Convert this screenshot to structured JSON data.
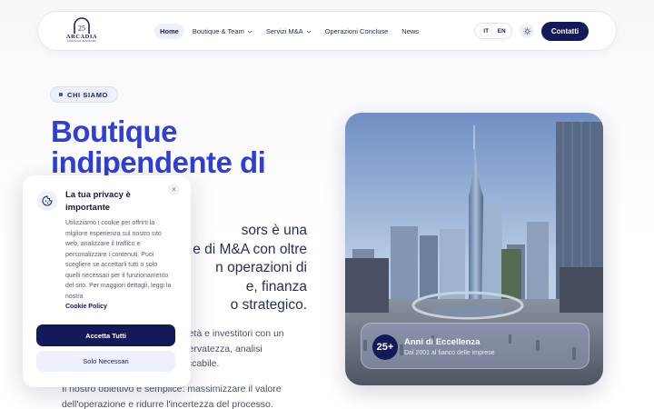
{
  "brand": {
    "logo_number": "25",
    "logo_name": "ARCADIA",
    "logo_tagline": "FINANCIAL ADVISORS"
  },
  "nav": {
    "items": [
      {
        "label": "Home",
        "active": true,
        "has_dropdown": false
      },
      {
        "label": "Boutique & Team",
        "active": false,
        "has_dropdown": true
      },
      {
        "label": "Servizi M&A",
        "active": false,
        "has_dropdown": true
      },
      {
        "label": "Operazioni Concluse",
        "active": false,
        "has_dropdown": false
      },
      {
        "label": "News",
        "active": false,
        "has_dropdown": false
      }
    ],
    "lang_it": "IT",
    "lang_en": "EN",
    "theme_icon": "sun-icon",
    "contact_label": "Contatti"
  },
  "hero": {
    "badge": "CHI SIAMO",
    "title": "Boutique indipendente di",
    "lead_visible": "sors è una\ne di M&A con oltre\nn operazioni di\ne, finanza\no strategico.",
    "body1_visible": "cietà e investitori con un\niservatezza, analisi\neccabile.",
    "body2": "Il nostro obiettivo è semplice: massimizzare il valore dell'operazione e ridurre l'incertezza del processo."
  },
  "stat": {
    "number": "25+",
    "title": "Anni di Eccellenza",
    "subtitle": "Dal 2001 al fianco delle imprese"
  },
  "cookie": {
    "icon": "cookie-icon",
    "title": "La tua privacy è importante",
    "text": "Utilizziamo i cookie per offrirti la migliore esperienza sul nostro sito web, analizzare il traffico e personalizzare i contenuti. Puoi scegliere se accettarli tutti o solo quelli necessari per il funzionamento del sito. Per maggiori dettagli, leggi la nostra",
    "link": "Cookie Policy",
    "close_icon": "close-icon",
    "accept_label": "Accetta Tutti",
    "necessary_label": "Solo Necessari"
  },
  "colors": {
    "primary": "#141a58",
    "accent": "#2f3fd6",
    "badge_bg": "#eef1fb"
  }
}
